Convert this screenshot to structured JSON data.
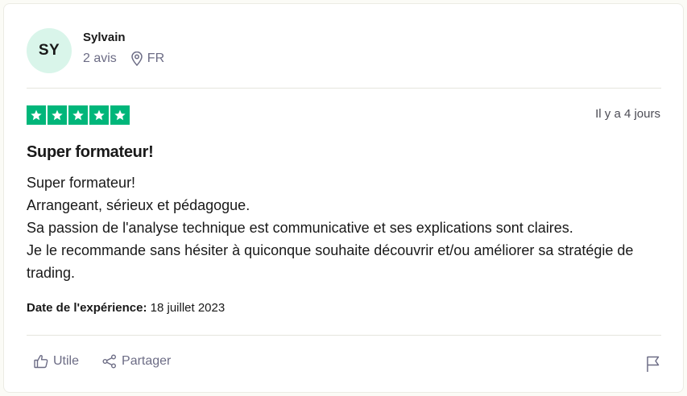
{
  "reviewer": {
    "initials": "SY",
    "name": "Sylvain",
    "reviews_count": "2 avis",
    "country": "FR"
  },
  "review": {
    "rating": 5,
    "relative_date": "Il y a 4 jours",
    "title": "Super formateur!",
    "body_lines": [
      "Super formateur!",
      "Arrangeant, sérieux et pédagogue.",
      "Sa passion de l'analyse technique est communicative et ses explications sont claires.",
      "Je le recommande sans hésiter à quiconque souhaite découvrir et/ou améliorer sa stratégie de trading."
    ],
    "experience_label": "Date de l'expérience:",
    "experience_date": "18 juillet 2023"
  },
  "actions": {
    "useful_label": "Utile",
    "share_label": "Partager"
  },
  "colors": {
    "star_green": "#00b67a",
    "avatar_bg": "#d9f5ea",
    "muted_text": "#6c6c85"
  },
  "icons": [
    "location-pin-icon",
    "star-icon",
    "thumbs-up-icon",
    "share-icon",
    "flag-icon"
  ]
}
